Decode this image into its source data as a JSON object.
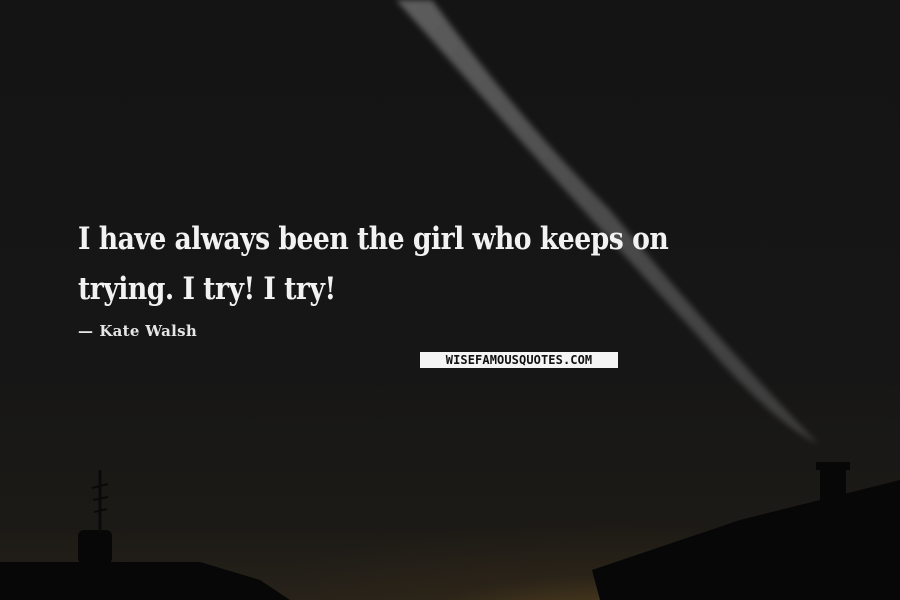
{
  "quote": {
    "text": "I have always been the girl who keeps on trying. I try! I try!"
  },
  "author": {
    "dash": "—",
    "name": "Kate Walsh"
  },
  "watermark": {
    "text": "WISEFAMOUSQUOTES.COM"
  },
  "colors": {
    "sky": "#141414",
    "text": "#f2f2f2",
    "horizon_glow": "#9a6e28",
    "silhouette": "#070707"
  }
}
